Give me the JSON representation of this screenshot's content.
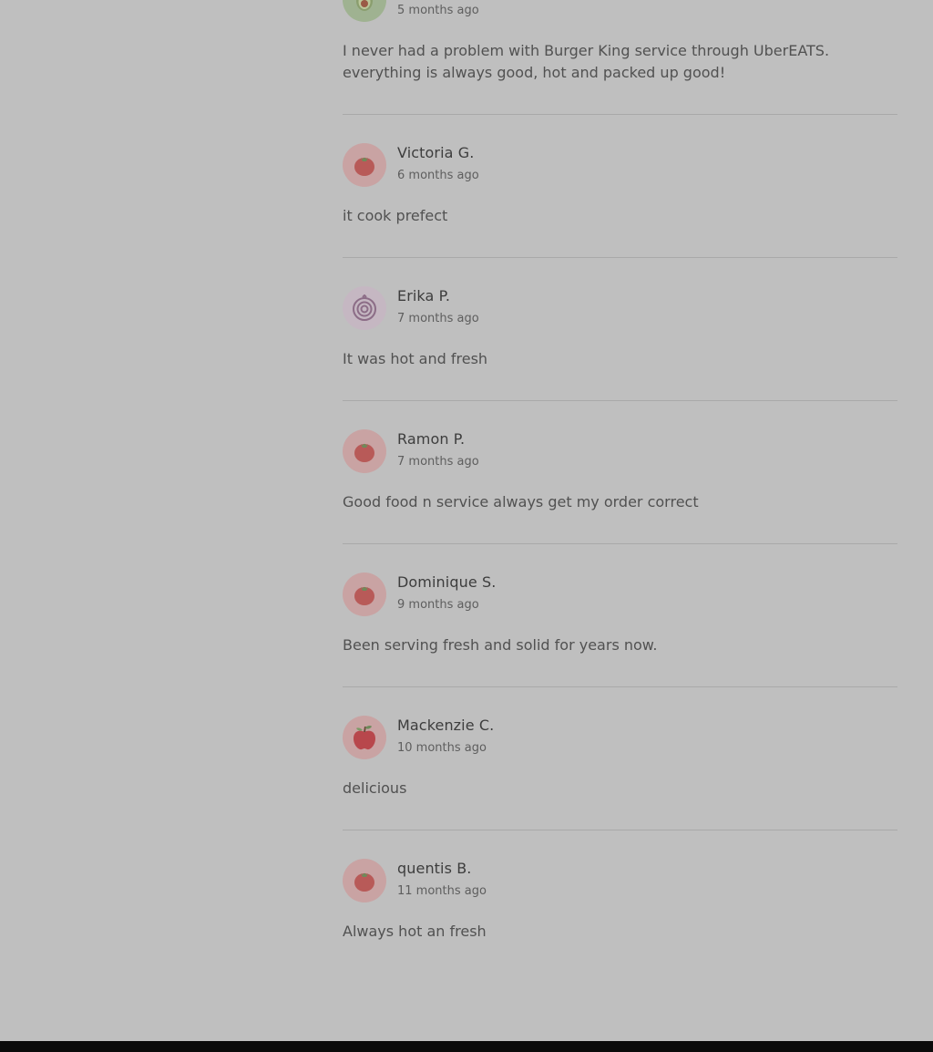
{
  "reviews": [
    {
      "name": "",
      "date": "5 months ago",
      "text": "I never had a problem with Burger King service through UberEATS. everything is always good, hot and packed up good!",
      "avatar_icon": "avocado-icon",
      "avatar_bg": "#9fb291"
    },
    {
      "name": "Victoria G.",
      "date": "6 months ago",
      "text": "it cook prefect",
      "avatar_icon": "tomato-icon",
      "avatar_bg": "#c9a3a3"
    },
    {
      "name": "Erika P.",
      "date": "7 months ago",
      "text": "It was hot and fresh",
      "avatar_icon": "onion-icon",
      "avatar_bg": "#c5b7c2"
    },
    {
      "name": "Ramon P.",
      "date": "7 months ago",
      "text": "Good food n service always get my order correct",
      "avatar_icon": "tomato-icon",
      "avatar_bg": "#c9a3a3"
    },
    {
      "name": "Dominique S.",
      "date": "9 months ago",
      "text": "Been serving fresh and solid for years now.",
      "avatar_icon": "tomato-icon",
      "avatar_bg": "#c9a3a3"
    },
    {
      "name": "Mackenzie C.",
      "date": "10 months ago",
      "text": "delicious",
      "avatar_icon": "apple-icon",
      "avatar_bg": "#c9a3a3"
    },
    {
      "name": "quentis B.",
      "date": "11 months ago",
      "text": "Always hot an fresh",
      "avatar_icon": "tomato-icon",
      "avatar_bg": "#c9a3a3"
    }
  ],
  "colors": {
    "page_background": "#bfbfbf",
    "divider": "#a9a9a9",
    "footer": "#0b0b0b",
    "name_text": "#3d3d3d",
    "body_text": "#515151"
  }
}
